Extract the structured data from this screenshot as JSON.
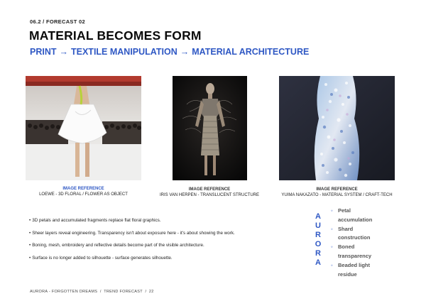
{
  "header": {
    "eyebrow": "06.2 / FORECAST 02",
    "title": "MATERIAL BECOMES FORM",
    "flow": [
      "PRINT",
      "TEXTILE MANIPULATION",
      "MATERIAL ARCHITECTURE"
    ],
    "arrow": "→"
  },
  "figures": [
    {
      "ref": "IMAGE REFERENCE",
      "caption": "LOEWE - 3D FLORAL / FLOWER AS OBJECT"
    },
    {
      "ref": "IMAGE REFERENCE",
      "caption": "IRIS VAN HERPEN - TRANSLUCENT STRUCTURE"
    },
    {
      "ref": "IMAGE REFERENCE",
      "caption": "YUIMA NAKAZATO - MATERIAL SYSTEM / CRAFT-TECH"
    }
  ],
  "bullets": [
    "3D petals and accumulated fragments replace flat floral graphics.",
    "Sheer layers reveal engineering. Transparency isn't about exposure here - it's about showing the work.",
    "Boning, mesh, embroidery and reflective details become part of the visible architecture.",
    "Surface is no longer added to silhouette - surface generates silhouette."
  ],
  "aurora_letters": [
    "A",
    "U",
    "R",
    "O",
    "R",
    "A"
  ],
  "side_list": [
    {
      "line1": "Petal",
      "line2": "accumulation"
    },
    {
      "line1": "Shard",
      "line2": "construction"
    },
    {
      "line1": "Boned",
      "line2": "transparency"
    },
    {
      "line1": "Beaded light",
      "line2": "residue"
    }
  ],
  "footer": {
    "left": "AURORA - FORGOTTEN DREAMS",
    "sep": "/",
    "middle": "TREND FORECAST",
    "page": "22"
  },
  "colors": {
    "accent": "#2f58c4",
    "text": "#111111",
    "background": "#ffffff"
  }
}
